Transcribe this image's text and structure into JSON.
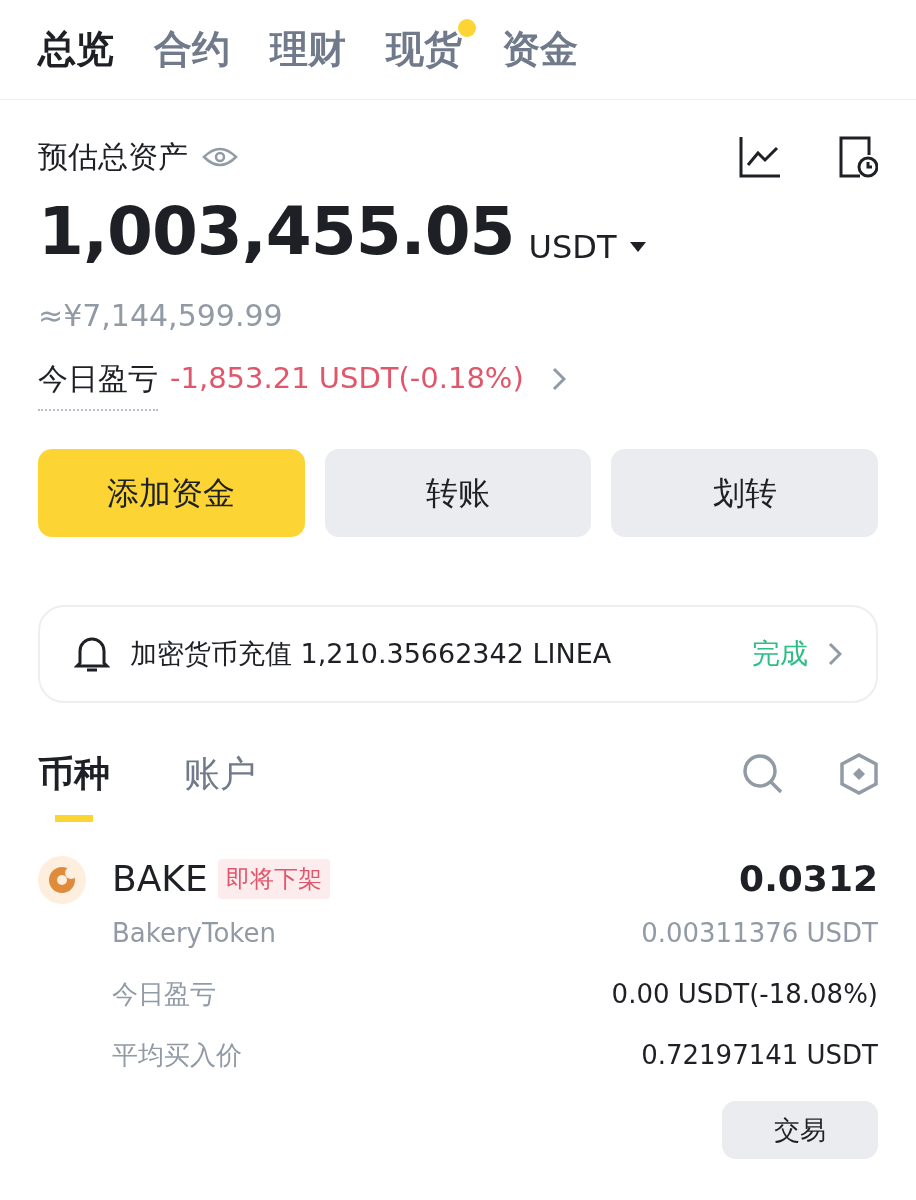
{
  "top_tabs": [
    {
      "label": "总览",
      "selected": true,
      "badge": false
    },
    {
      "label": "合约",
      "selected": false,
      "badge": false
    },
    {
      "label": "理财",
      "selected": false,
      "badge": false
    },
    {
      "label": "现货",
      "selected": false,
      "badge": true
    },
    {
      "label": "资金",
      "selected": false,
      "badge": false
    }
  ],
  "summary": {
    "title": "预估总资产",
    "total": "1,003,455.05",
    "currency": "USDT",
    "fiat": "≈¥7,144,599.99",
    "pnl_label": "今日盈亏",
    "pnl_value": "-1,853.21 USDT(-0.18%)"
  },
  "actions": [
    {
      "label": "添加资金",
      "kind": "primary"
    },
    {
      "label": "转账",
      "kind": "secondary"
    },
    {
      "label": "划转",
      "kind": "secondary"
    }
  ],
  "notice": {
    "text": "加密货币充值 1,210.35662342 LINEA",
    "status": "完成"
  },
  "asset_tabs": [
    {
      "label": "币种",
      "selected": true
    },
    {
      "label": "账户",
      "selected": false
    }
  ],
  "coins": [
    {
      "symbol": "BAKE",
      "tag": "即将下架",
      "name": "BakeryToken",
      "amount": "0.0312",
      "value": "0.00311376 USDT",
      "details": [
        {
          "label": "今日盈亏",
          "value": "0.00 USDT(-18.08%)"
        },
        {
          "label": "平均买入价",
          "value": "0.72197141 USDT"
        }
      ],
      "button": "交易"
    }
  ]
}
